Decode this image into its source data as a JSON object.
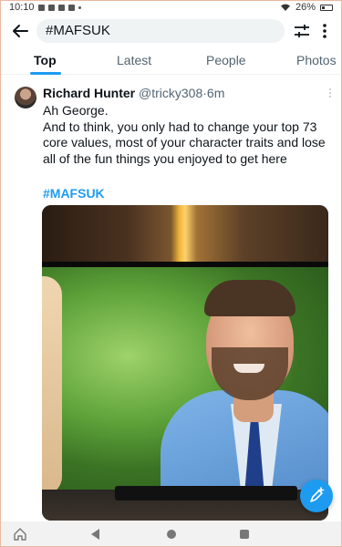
{
  "status_bar": {
    "time": "10:10",
    "battery": "26%",
    "icons": [
      "message-icon",
      "notification-icon",
      "notification-icon",
      "notification-icon",
      "dot-icon",
      "wifi-icon",
      "battery-icon"
    ]
  },
  "header": {
    "back_icon": "arrow-left-icon",
    "search_value": "#MAFSUK",
    "filter_icon": "sliders-icon",
    "more_icon": "vertical-ellipsis-icon"
  },
  "tabs": [
    {
      "label": "Top",
      "active": true
    },
    {
      "label": "Latest",
      "active": false
    },
    {
      "label": "People",
      "active": false
    },
    {
      "label": "Photos",
      "active": false
    }
  ],
  "tweet": {
    "author_name": "Richard Hunter",
    "handle": "@tricky308",
    "separator": "·",
    "time": "6m",
    "lines": [
      "Ah George.",
      "And to think, you only had to change your top 73 core values, most of your character traits and lose all of the fun things you enjoyed to get here"
    ],
    "hashtag": "#MAFSUK",
    "media_icon": "tv-screen-photo"
  },
  "fab": {
    "icon": "compose-plus-icon"
  },
  "nav_bar": {
    "icons": [
      "home-icon",
      "back-triangle-icon",
      "home-circle-icon",
      "recents-square-icon"
    ]
  },
  "colors": {
    "accent": "#1d9bf0",
    "text": "#0f1419",
    "muted": "#536471",
    "search_bg": "#eff3f4"
  }
}
